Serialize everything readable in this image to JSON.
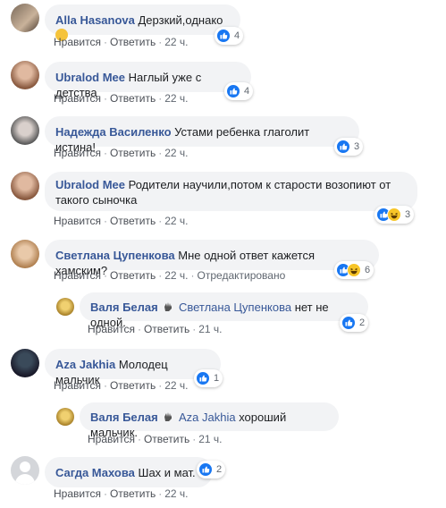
{
  "comments": [
    {
      "author": "Alla Hasanova",
      "text": "Дерзкий,однако",
      "emoji": "upside-down-face-icon",
      "like": "Нравится",
      "reply": "Ответить",
      "time": "22 ч.",
      "reactions": "4"
    },
    {
      "author": "Ubralod Mee",
      "text": "Наглый уже с детства",
      "like": "Нравится",
      "reply": "Ответить",
      "time": "22 ч.",
      "reactions": "4"
    },
    {
      "author": "Надежда Василенко",
      "text": "Устами ребенка глаголит истина!",
      "like": "Нравится",
      "reply": "Ответить",
      "time": "22 ч.",
      "reactions": "3"
    },
    {
      "author": "Ubralod Mee",
      "text_line1": "Родители научили,потом к старости возопиют от",
      "text_line2": "такого сыночка",
      "like": "Нравится",
      "reply": "Ответить",
      "time": "22 ч.",
      "reactions": "3"
    },
    {
      "author": "Светлана Цупенкова",
      "text": "Мне одной ответ кажется хамским?",
      "like": "Нравится",
      "reply": "Ответить",
      "time": "22 ч.",
      "edited": "Отредактировано",
      "reactions": "6"
    },
    {
      "author": "Валя Белая",
      "mention": "Светлана Цупенкова",
      "text": "нет не одной.",
      "like": "Нравится",
      "reply": "Ответить",
      "time": "21 ч.",
      "reactions": "2"
    },
    {
      "author": "Aza Jakhia",
      "text": "Молодец мальчик",
      "like": "Нравится",
      "reply": "Ответить",
      "time": "22 ч.",
      "reactions": "1"
    },
    {
      "author": "Валя Белая",
      "mention": "Aza Jakhia",
      "text": "хороший мальчик.",
      "like": "Нравится",
      "reply": "Ответить",
      "time": "21 ч."
    },
    {
      "author": "Сагда Махова",
      "text": "Шах и мат.",
      "like": "Нравится",
      "reply": "Ответить",
      "time": "22 ч.",
      "reactions": "2"
    }
  ],
  "colors": {
    "link": "#385898",
    "bubble": "#f2f3f5",
    "like": "#1877f2",
    "haha": "#f7c528"
  }
}
